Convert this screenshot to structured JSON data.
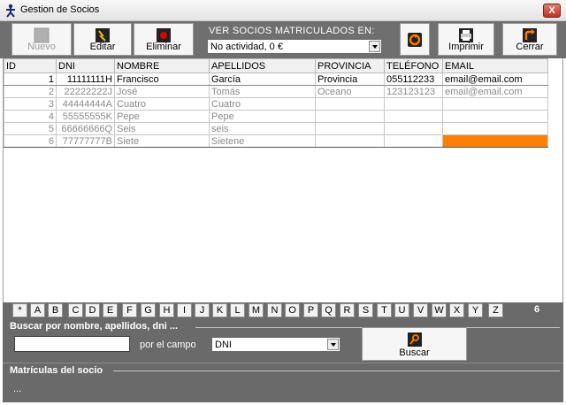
{
  "window": {
    "title": "Gestion de Socios",
    "close_label": "X"
  },
  "toolbar": {
    "nuevo_label": "Nuevo",
    "editar_label": "Editar",
    "eliminar_label": "Eliminar",
    "ver_label": "VER SOCIOS MATRICULADOS EN:",
    "actividad_value": "No actividad, 0 €",
    "imprimir_label": "Imprimir",
    "cerrar_label": "Cerrar"
  },
  "table": {
    "headers": [
      "ID",
      "DNI",
      "NOMBRE",
      "APELLIDOS",
      "PROVINCIA",
      "TELÉFONO",
      "EMAIL"
    ],
    "rows": [
      [
        "1",
        "11111111H",
        "Francisco",
        "García",
        "Provincia",
        "055112233",
        "email@email.com"
      ],
      [
        "2",
        "22222222J",
        "José",
        "Tomás",
        "Oceano",
        "123123123",
        "email@email.com"
      ],
      [
        "3",
        "44444444A",
        "Cuatro",
        "Cuatro",
        "",
        "",
        ""
      ],
      [
        "4",
        "55555555K",
        "Pepe",
        "Pepe",
        "",
        "",
        ""
      ],
      [
        "5",
        "66666666Q",
        "Seis",
        "seis",
        "",
        "",
        ""
      ],
      [
        "6",
        "77777777B",
        "Siete",
        "Sietene",
        "",
        "",
        ""
      ]
    ]
  },
  "letters": [
    "*",
    "A",
    "B",
    "C",
    "D",
    "E",
    "F",
    "G",
    "H",
    "I",
    "J",
    "K",
    "L",
    "M",
    "N",
    "O",
    "P",
    "Q",
    "R",
    "S",
    "T",
    "U",
    "V",
    "W",
    "X",
    "Y",
    "Z"
  ],
  "record_count": "6",
  "search": {
    "title": "Buscar por nombre, apellidos, dni ...",
    "input_value": "",
    "por_label": "por el campo",
    "campo_value": "DNI",
    "buscar_label": "Buscar"
  },
  "matriculas": {
    "title": "Matrículas del socio",
    "content": "..."
  },
  "colors": {
    "accent_orange": "#ff8000",
    "panel_gray": "#6a6a6a"
  }
}
